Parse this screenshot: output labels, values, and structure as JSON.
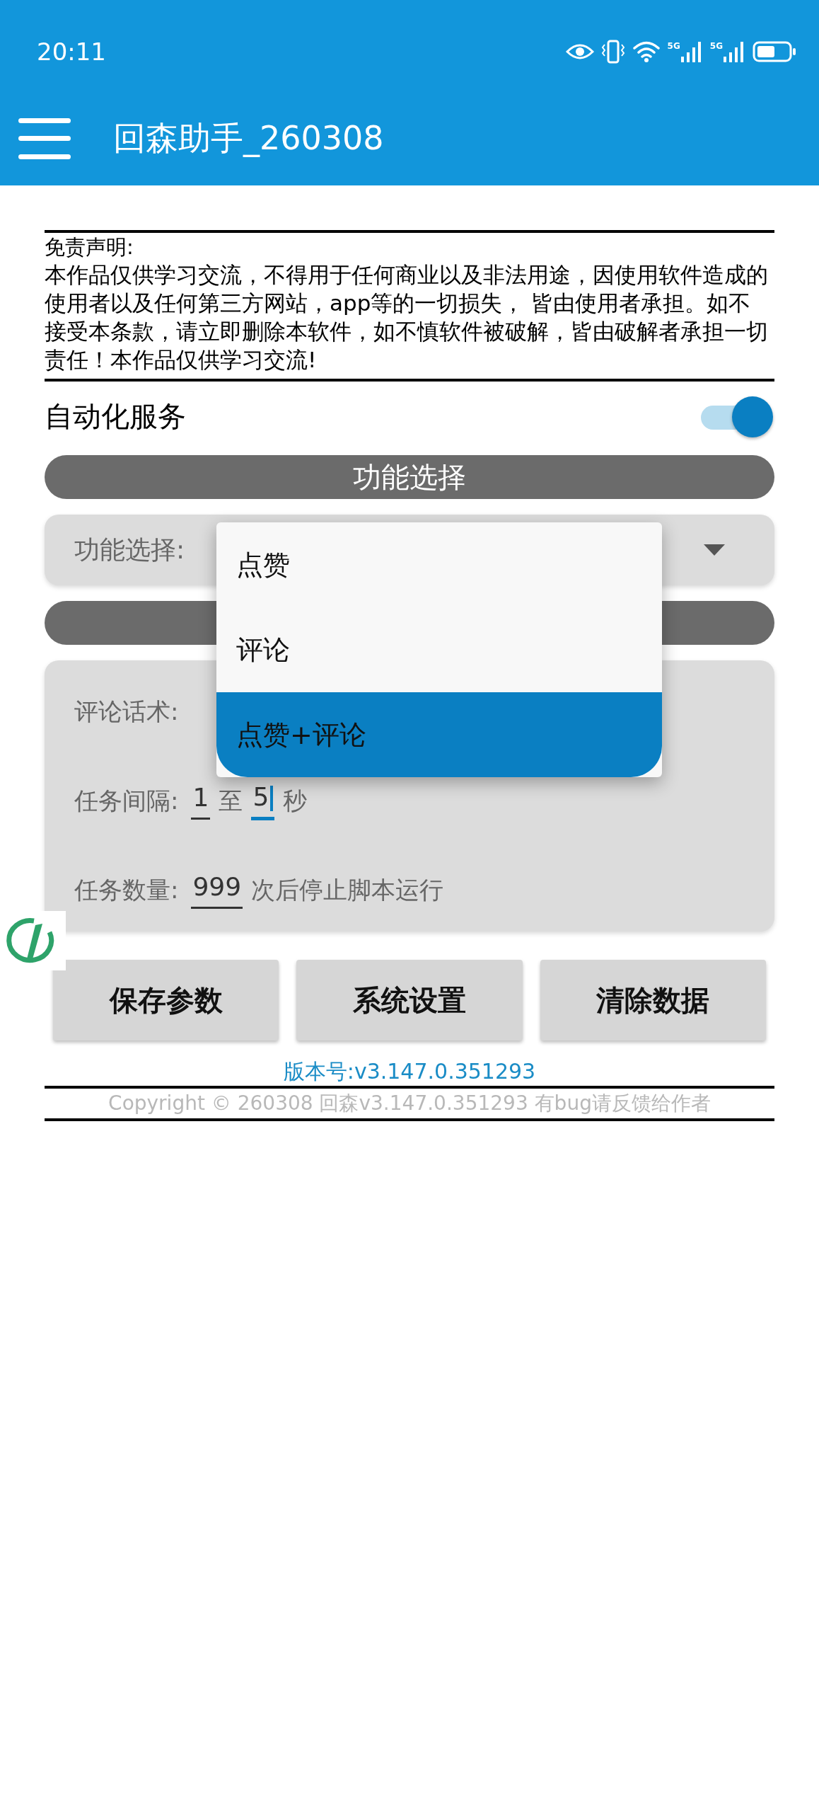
{
  "status_bar": {
    "time": "20:11",
    "networks": [
      "5G",
      "5G"
    ]
  },
  "app_bar": {
    "title": "回森助手_260308"
  },
  "disclaimer": {
    "heading": "免责声明:",
    "body": "本作品仅供学习交流，不得用于任何商业以及非法用途，因使用软件造成的使用者以及任何第三方网站，app等的一切损失， 皆由使用者承担。如不接受本条款，请立即删除本软件，如不慎软件被破解，皆由破解者承担一切责任！本作品仅供学习交流!"
  },
  "auto_service": {
    "label": "自动化服务",
    "on": true
  },
  "section_header": {
    "title": "功能选择"
  },
  "function_select": {
    "label": "功能选择:",
    "expanded": true,
    "options": [
      {
        "label": "点赞",
        "selected": false
      },
      {
        "label": "评论",
        "selected": false
      },
      {
        "label": "点赞+评论",
        "selected": true
      }
    ]
  },
  "params": {
    "comment_label": "评论话术:",
    "interval": {
      "label": "任务间隔:",
      "min": "1",
      "separator": "至",
      "max": "5",
      "unit": "秒",
      "max_focused": true
    },
    "count": {
      "label": "任务数量:",
      "value": "999",
      "suffix": "次后停止脚本运行"
    }
  },
  "buttons": [
    "保存参数",
    "系统设置",
    "清除数据"
  ],
  "version": "版本号:v3.147.0.351293",
  "copyright": "Copyright © 260308 回森v3.147.0.351293 有bug请反馈给作者"
}
